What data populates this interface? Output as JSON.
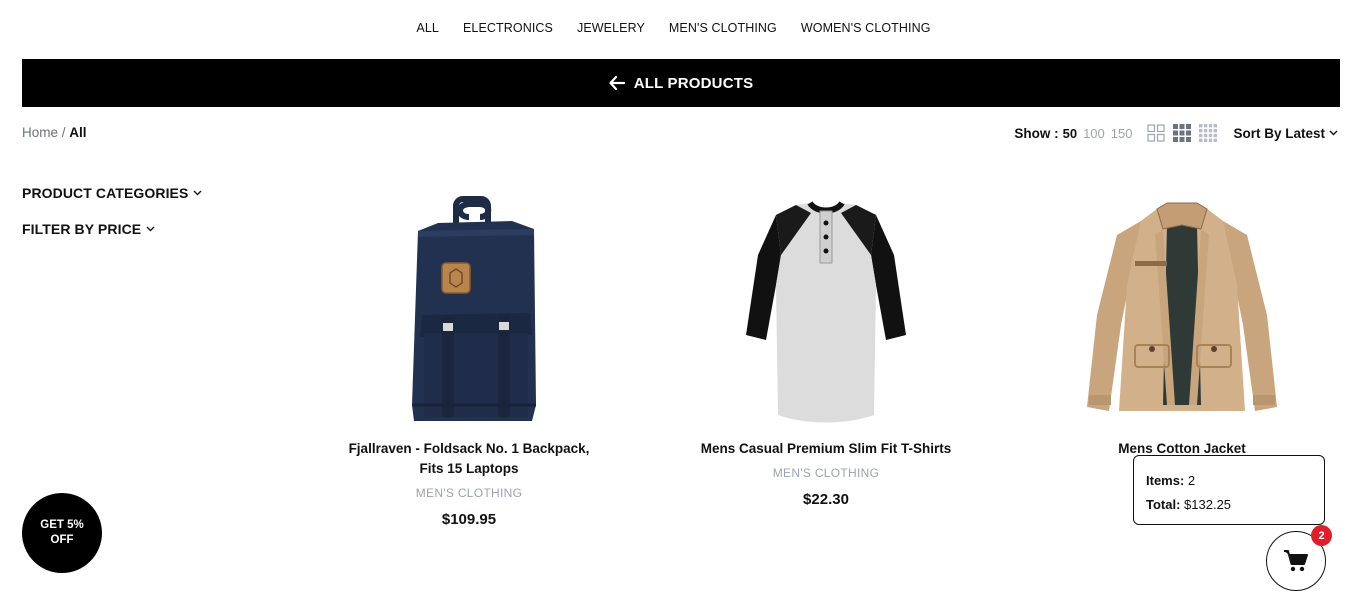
{
  "nav": {
    "items": [
      {
        "label": "ALL"
      },
      {
        "label": "ELECTRONICS"
      },
      {
        "label": "JEWELERY"
      },
      {
        "label": "MEN'S CLOTHING"
      },
      {
        "label": "WOMEN'S CLOTHING"
      }
    ]
  },
  "banner": {
    "title": "ALL PRODUCTS",
    "icon": "arrow-left-icon"
  },
  "breadcrumb": {
    "home": "Home",
    "separator": " / ",
    "current": "All"
  },
  "toolbar": {
    "show_label": "Show :",
    "show_options": [
      {
        "label": "50",
        "active": true
      },
      {
        "label": "100",
        "active": false
      },
      {
        "label": "150",
        "active": false
      }
    ],
    "views": [
      {
        "icon": "grid-2-icon",
        "active": false
      },
      {
        "icon": "grid-3-icon",
        "active": true
      },
      {
        "icon": "grid-4-icon",
        "active": false
      }
    ],
    "sort_label": "Sort By Latest"
  },
  "sidebar": {
    "categories_label": "PRODUCT CATEGORIES",
    "price_label": "FILTER BY PRICE"
  },
  "products": [
    {
      "title": "Fjallraven - Foldsack No. 1 Backpack, Fits 15 Laptops",
      "category": "MEN'S CLOTHING",
      "price": "$109.95",
      "image": "backpack-image"
    },
    {
      "title": "Mens Casual Premium Slim Fit T-Shirts",
      "category": "MEN'S CLOTHING",
      "price": "$22.30",
      "image": "raglan-tshirt-image"
    },
    {
      "title": "Mens Cotton Jacket",
      "category": "",
      "price": "",
      "image": "cotton-jacket-image"
    }
  ],
  "promo": {
    "line1": "GET 5%",
    "line2": "OFF"
  },
  "cart": {
    "items_label": "Items:",
    "items_value": "2",
    "total_label": "Total:",
    "total_value": "$132.25",
    "badge": "2"
  },
  "colors": {
    "accent": "#000000",
    "badge": "#e11d2a",
    "muted": "#9ca3af"
  }
}
